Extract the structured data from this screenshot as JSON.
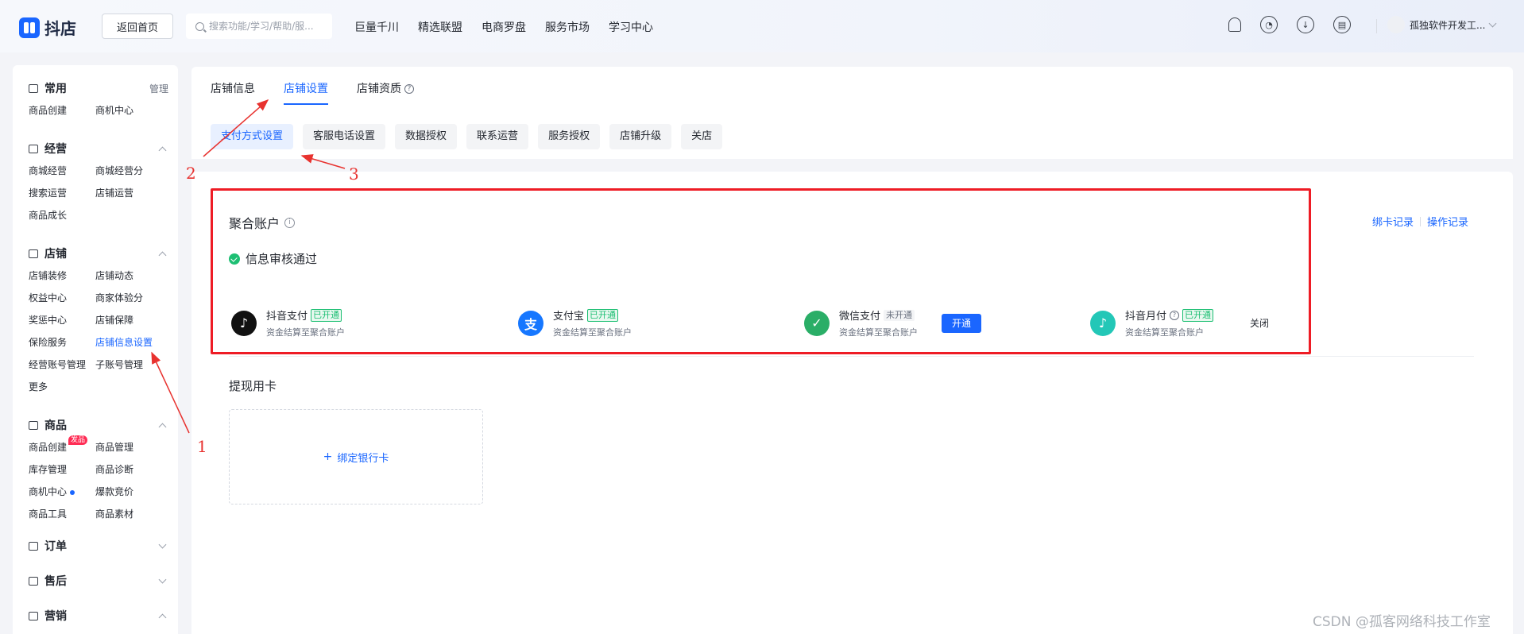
{
  "header": {
    "logo": "抖店",
    "home_button": "返回首页",
    "search_placeholder": "搜索功能/学习/帮助/服...",
    "nav": [
      "巨量千川",
      "精选联盟",
      "电商罗盘",
      "服务市场",
      "学习中心"
    ],
    "icons": [
      "bell-icon",
      "chat-icon",
      "download-icon",
      "store-icon"
    ],
    "user_name": "孤独软件开发工..."
  },
  "sidebar": {
    "common": {
      "title": "常用",
      "manage": "管理",
      "items": [
        "商品创建",
        "商机中心"
      ]
    },
    "operation": {
      "title": "经营",
      "items": [
        "商城经营",
        "商城经营分",
        "搜索运营",
        "店铺运营",
        "商品成长"
      ]
    },
    "shop": {
      "title": "店铺",
      "items": [
        "店铺装修",
        "店铺动态",
        "权益中心",
        "商家体验分",
        "奖惩中心",
        "店铺保障",
        "保险服务",
        "店铺信息设置",
        "经营账号管理",
        "子账号管理",
        "更多"
      ]
    },
    "goods": {
      "title": "商品",
      "badge": "发品",
      "items": [
        "商品创建",
        "商品管理",
        "库存管理",
        "商品诊断",
        "商机中心",
        "爆款竞价",
        "商品工具",
        "商品素材"
      ]
    },
    "order": {
      "title": "订单"
    },
    "aftersale": {
      "title": "售后"
    },
    "marketing": {
      "title": "营销"
    }
  },
  "tabs": [
    "店铺信息",
    "店铺设置",
    "店铺资质"
  ],
  "subtabs": [
    "支付方式设置",
    "客服电话设置",
    "数据授权",
    "联系运营",
    "服务授权",
    "店铺升级",
    "关店"
  ],
  "account": {
    "title": "聚合账户",
    "status": "信息审核通过",
    "links": [
      "绑卡记录",
      "操作记录"
    ],
    "payments": [
      {
        "name": "抖音支付",
        "tag": "已开通",
        "desc": "资金结算至聚合账户",
        "icon": "douyin-pay-icon"
      },
      {
        "name": "支付宝",
        "tag": "已开通",
        "desc": "资金结算至聚合账户",
        "icon": "alipay-icon"
      },
      {
        "name": "微信支付",
        "tag": "未开通",
        "desc": "资金结算至聚合账户",
        "action": "开通",
        "icon": "wechat-pay-icon"
      },
      {
        "name": "抖音月付",
        "tag": "已开通",
        "desc": "资金结算至聚合账户",
        "action": "关闭",
        "icon": "douyin-monthly-icon"
      }
    ]
  },
  "withdraw": {
    "title": "提现用卡",
    "bind_label": "绑定银行卡"
  },
  "annotations": [
    "1",
    "2",
    "3"
  ],
  "watermark": "CSDN @孤客网络科技工作室",
  "colors": {
    "accent": "#1a66ff",
    "success": "#1dbf73",
    "highlight": "#ee1c25",
    "annotation": "#e8322f"
  }
}
